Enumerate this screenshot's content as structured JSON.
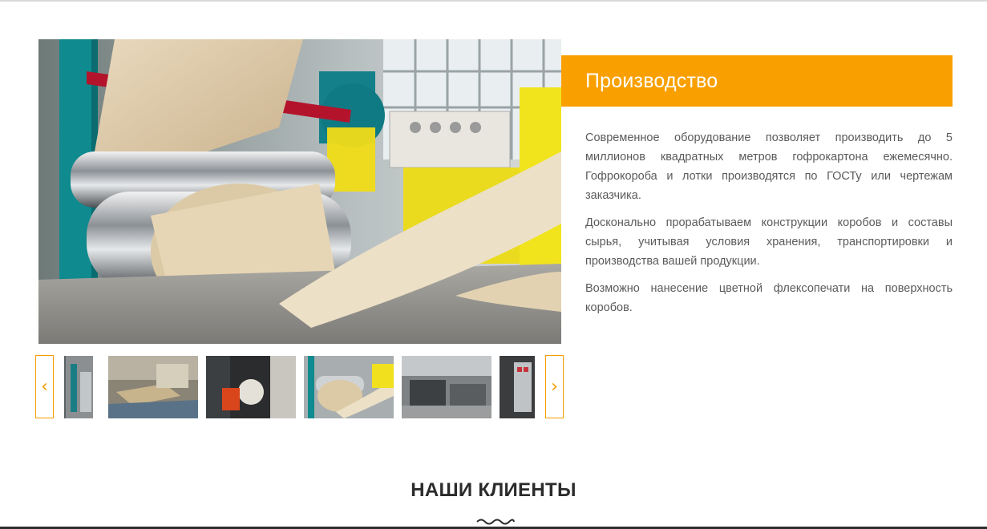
{
  "section": {
    "title": "Производство",
    "paragraphs": [
      "Современное оборудование позволяет производить до 5 миллионов квадратных метров гофрокартона ежемесячно. Гофрокороба и лотки производятся по ГОСТу или чертежам заказчика.",
      "Досконально прорабатываем конструкции коробов и составы сырья, учитывая условия хранения, транспортировки и производства вашей продукции.",
      "Возможно нанесение цветной флексопечати на поверхность коробов."
    ]
  },
  "carousel": {
    "prev_label": "‹",
    "next_label": "›",
    "thumbnails": [
      {
        "name": "paper-rolls-thumb"
      },
      {
        "name": "pallets-thumb"
      },
      {
        "name": "forklift-thumb"
      },
      {
        "name": "corrugator-thumb"
      },
      {
        "name": "workshop-thumb"
      },
      {
        "name": "machine-panel-thumb"
      }
    ]
  },
  "clients": {
    "title": "НАШИ КЛИЕНТЫ"
  },
  "colors": {
    "accent": "#f9a000",
    "text": "#5b5b5b",
    "heading": "#2b2b2b"
  }
}
